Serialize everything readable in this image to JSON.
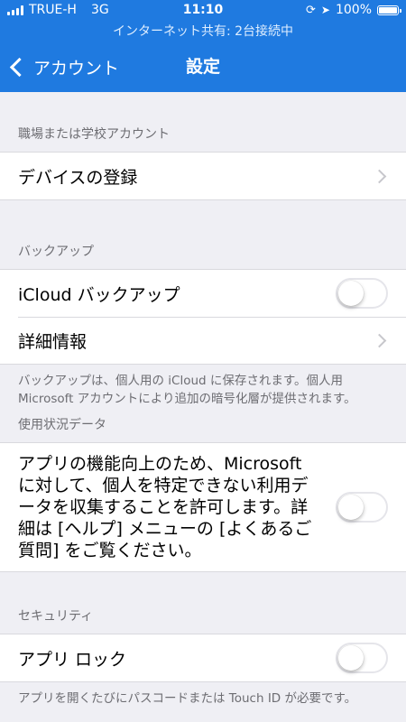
{
  "status_bar": {
    "carrier": "TRUE-H",
    "network": "3G",
    "time": "11:10",
    "battery": "100%"
  },
  "hotspot_banner": "インターネット共有: 2台接続中",
  "nav": {
    "back_label": "アカウント",
    "title": "設定"
  },
  "sections": {
    "work": {
      "header": "職場または学校アカウント",
      "device_register_label": "デバイスの登録"
    },
    "backup": {
      "header": "バックアップ",
      "icloud_label": "iCloud バックアップ",
      "icloud_on": false,
      "details_label": "詳細情報",
      "footer_line1": "バックアップは、個人用の iCloud に保存されます。個人用",
      "footer_line2": "Microsoft アカウントにより追加の暗号化層が提供されます。"
    },
    "usage": {
      "header": "使用状況データ",
      "line1": "アプリの機能向上のため、Microsoft",
      "line2": "に対して、個人を特定できない利用デ",
      "line3": "ータを収集することを許可します。詳",
      "line4": "細は [ヘルプ] メニューの [よくあるご",
      "line5": "質問] をご覧ください。",
      "enabled": false
    },
    "security": {
      "header": "セキュリティ",
      "app_lock_label": "アプリ ロック",
      "app_lock_on": false,
      "footer": "アプリを開くたびにパスコードまたは Touch ID が必要です。"
    }
  },
  "colors": {
    "accent": "#1f7ae0",
    "background": "#efeff4"
  }
}
